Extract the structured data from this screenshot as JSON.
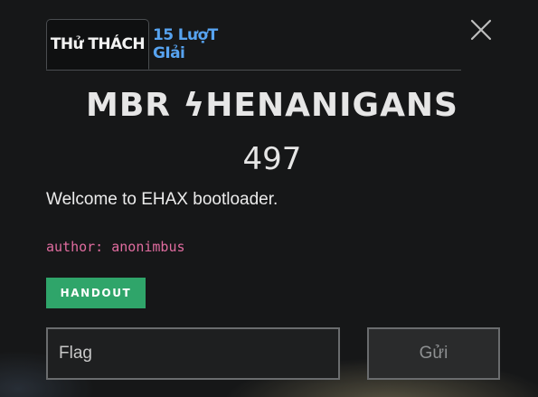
{
  "tabs": [
    {
      "label": "THử THÁCH",
      "active": true
    },
    {
      "label": "15 LượT GIải",
      "active": false
    }
  ],
  "close": {
    "icon": "close-icon"
  },
  "challenge": {
    "title": "MBR ϟHENANIGANS",
    "points": "497",
    "description": "Welcome to EHAX bootloader.",
    "author": "author: anonimbus"
  },
  "handout": {
    "label": "HANDOUT",
    "color": "#2fa56a"
  },
  "flag": {
    "placeholder": "Flag",
    "value": ""
  },
  "submit": {
    "label": "Gửi"
  },
  "colors": {
    "background": "#161718",
    "tab_link": "#57a3f0",
    "author": "#e06c9f",
    "accent_green": "#2fa56a"
  }
}
